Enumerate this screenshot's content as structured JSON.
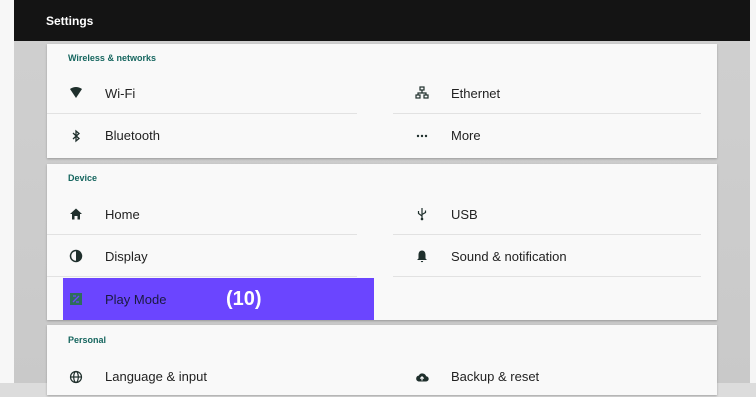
{
  "app": {
    "title": "Settings"
  },
  "sections": {
    "wireless": {
      "title": "Wireless & networks",
      "items": [
        {
          "label": "Wi-Fi",
          "icon": "wifi-icon"
        },
        {
          "label": "Ethernet",
          "icon": "ethernet-icon"
        },
        {
          "label": "Bluetooth",
          "icon": "bluetooth-icon"
        },
        {
          "label": "More",
          "icon": "more-icon"
        }
      ]
    },
    "device": {
      "title": "Device",
      "items": [
        {
          "label": "Home",
          "icon": "home-icon"
        },
        {
          "label": "USB",
          "icon": "usb-icon"
        },
        {
          "label": "Display",
          "icon": "display-icon"
        },
        {
          "label": "Sound & notification",
          "icon": "bell-icon"
        },
        {
          "label": "Play Mode",
          "icon": "play-mode-icon",
          "selected": true
        }
      ]
    },
    "personal": {
      "title": "Personal",
      "items": [
        {
          "label": "Language & input",
          "icon": "globe-icon"
        },
        {
          "label": "Backup & reset",
          "icon": "cloud-upload-icon"
        }
      ]
    }
  },
  "overlay": {
    "badge": "(10)"
  },
  "colors": {
    "appbar": "#141414",
    "section_title": "#16665f",
    "selection": "#6b45ff"
  }
}
